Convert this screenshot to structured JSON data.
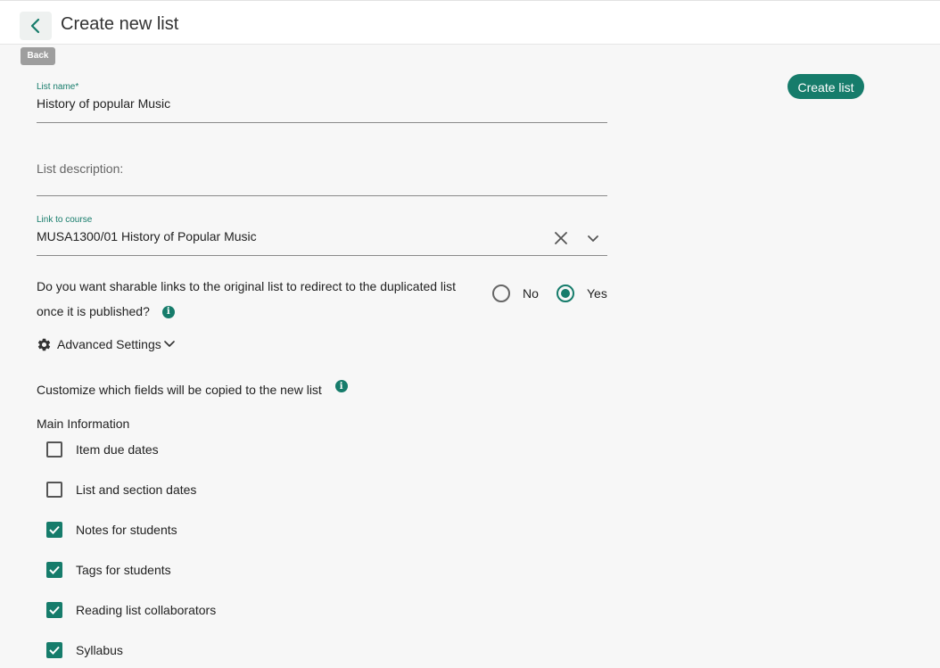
{
  "header": {
    "title": "Create new list",
    "back_tooltip": "Back"
  },
  "actions": {
    "create_label": "Create list"
  },
  "form": {
    "list_name": {
      "label": "List name*",
      "value": "History of popular Music"
    },
    "list_description": {
      "placeholder": "List description:"
    },
    "link_to_course": {
      "label": "Link to course",
      "value": "MUSA1300/01 History of Popular Music"
    },
    "redirect_question": {
      "text": "Do you want sharable links to the original list to redirect to the duplicated list once it is published?",
      "options": [
        {
          "label": "No",
          "selected": false
        },
        {
          "label": "Yes",
          "selected": true
        }
      ]
    },
    "advanced_settings_label": "Advanced Settings",
    "customize_label": "Customize which fields will be copied to the new list",
    "main_info_title": "Main Information",
    "checkboxes": [
      {
        "label": "Item due dates",
        "checked": false
      },
      {
        "label": "List and section dates",
        "checked": false
      },
      {
        "label": "Notes for students",
        "checked": true
      },
      {
        "label": "Tags for students",
        "checked": true
      },
      {
        "label": "Reading list collaborators",
        "checked": true
      },
      {
        "label": "Syllabus",
        "checked": true
      }
    ]
  },
  "colors": {
    "accent": "#167c6b",
    "background": "#f7f7f7"
  }
}
